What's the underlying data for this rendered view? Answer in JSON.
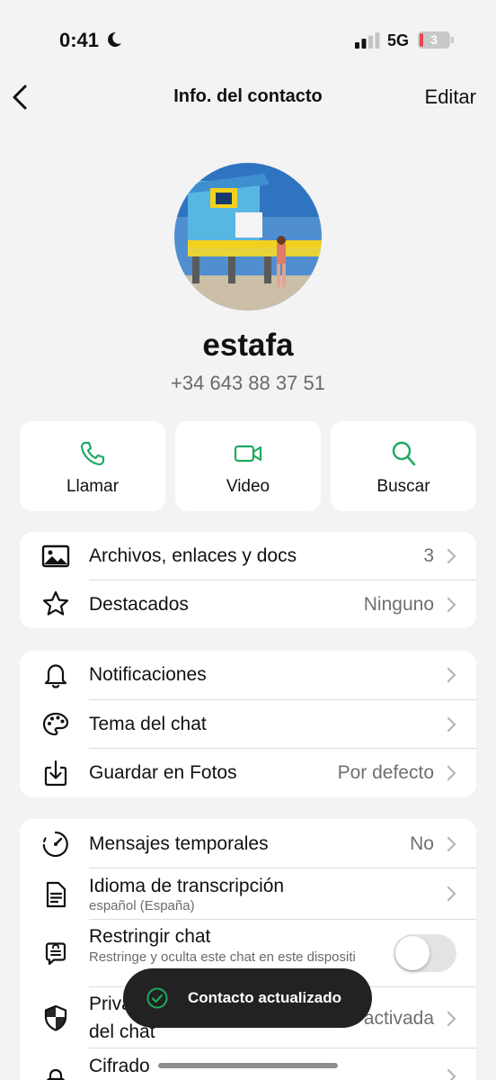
{
  "status_bar": {
    "time": "0:41",
    "network": "5G",
    "battery_level": "3",
    "moon_icon": "moon-icon",
    "signal_icon": "signal-bars-icon"
  },
  "nav": {
    "title": "Info. del contacto",
    "edit_label": "Editar",
    "back_icon": "chevron-left-icon"
  },
  "profile": {
    "name": "estafa",
    "phone": "+34 643 88 37 51"
  },
  "actions": [
    {
      "label": "Llamar",
      "icon": "phone-icon"
    },
    {
      "label": "Video",
      "icon": "video-icon"
    },
    {
      "label": "Buscar",
      "icon": "search-icon"
    }
  ],
  "media_section": {
    "files": {
      "label": "Archivos, enlaces y docs",
      "value": "3",
      "icon": "image-icon"
    },
    "starred": {
      "label": "Destacados",
      "value": "Ninguno",
      "icon": "star-icon"
    }
  },
  "settings_section": {
    "notifications": {
      "label": "Notificaciones",
      "icon": "bell-icon"
    },
    "theme": {
      "label": "Tema del chat",
      "icon": "palette-icon"
    },
    "save_photos": {
      "label": "Guardar en Fotos",
      "value": "Por defecto",
      "icon": "download-icon"
    }
  },
  "privacy_section": {
    "disappearing": {
      "label": "Mensajes temporales",
      "value": "No",
      "icon": "timer-icon"
    },
    "transcription": {
      "label": "Idioma de transcripción",
      "sub": "español (España)",
      "icon": "document-icon"
    },
    "restrict": {
      "label": "Restringir chat",
      "sub": "Restringe y oculta este chat en este dispositi",
      "toggle_on": false,
      "icon": "chat-lock-icon"
    },
    "advanced_privacy": {
      "label_line1": "Priva",
      "label_line2": "del chat",
      "value": "activada",
      "icon": "shield-icon"
    },
    "encryption": {
      "label": "Cifrado",
      "icon": "lock-icon"
    }
  },
  "toast": {
    "text": "Contacto actualizado",
    "icon": "check-circle-icon"
  },
  "colors": {
    "accent": "#1daa61",
    "background": "#f3f3f3",
    "card": "#ffffff",
    "toast": "#222222"
  }
}
